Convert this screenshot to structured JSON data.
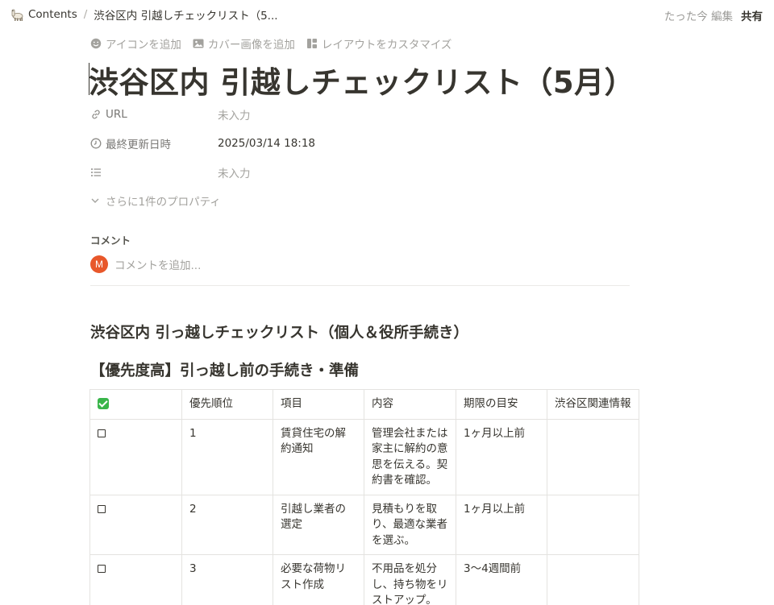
{
  "breadcrumb": {
    "root": "Contents",
    "separator": "/",
    "current": "渋谷区内 引越しチェックリスト（5..."
  },
  "topbar": {
    "edited": "たった今 編集",
    "share": "共有"
  },
  "page_actions": {
    "add_icon": "アイコンを追加",
    "add_cover": "カバー画像を追加",
    "customize_layout": "レイアウトをカスタマイズ"
  },
  "title": "渋谷区内 引越しチェックリスト（5月）",
  "properties": [
    {
      "icon": "link-icon",
      "name": "URL",
      "value": "未入力",
      "empty": true
    },
    {
      "icon": "clock-icon",
      "name": "最終更新日時",
      "value": "2025/03/14 18:18",
      "empty": false
    },
    {
      "icon": "list-icon",
      "name": "",
      "value": "未入力",
      "empty": true
    }
  ],
  "more_properties": "さらに1件のプロパティ",
  "comments": {
    "heading": "コメント",
    "avatar_initial": "M",
    "placeholder": "コメントを追加...",
    "avatar_color": "#e8572a"
  },
  "heading2": "渋谷区内 引っ越しチェックリスト（個人＆役所手続き）",
  "heading3": "【優先度高】引っ越し前の手続き・準備",
  "table": {
    "headers": [
      "",
      "優先順位",
      "項目",
      "内容",
      "期限の目安",
      "渋谷区関連情報"
    ],
    "rows": [
      {
        "priority": "1",
        "item": "賃貸住宅の解約通知",
        "content": "管理会社または家主に解約の意思を伝える。契約書を確認。",
        "deadline": "1ヶ月以上前",
        "info": ""
      },
      {
        "priority": "2",
        "item": "引越し業者の選定",
        "content": "見積もりを取り、最適な業者を選ぶ。",
        "deadline": "1ヶ月以上前",
        "info": ""
      },
      {
        "priority": "3",
        "item": "必要な荷物リスト作成",
        "content": "不用品を処分し、持ち物をリストアップ。",
        "deadline": "3〜4週間前",
        "info": ""
      }
    ]
  }
}
